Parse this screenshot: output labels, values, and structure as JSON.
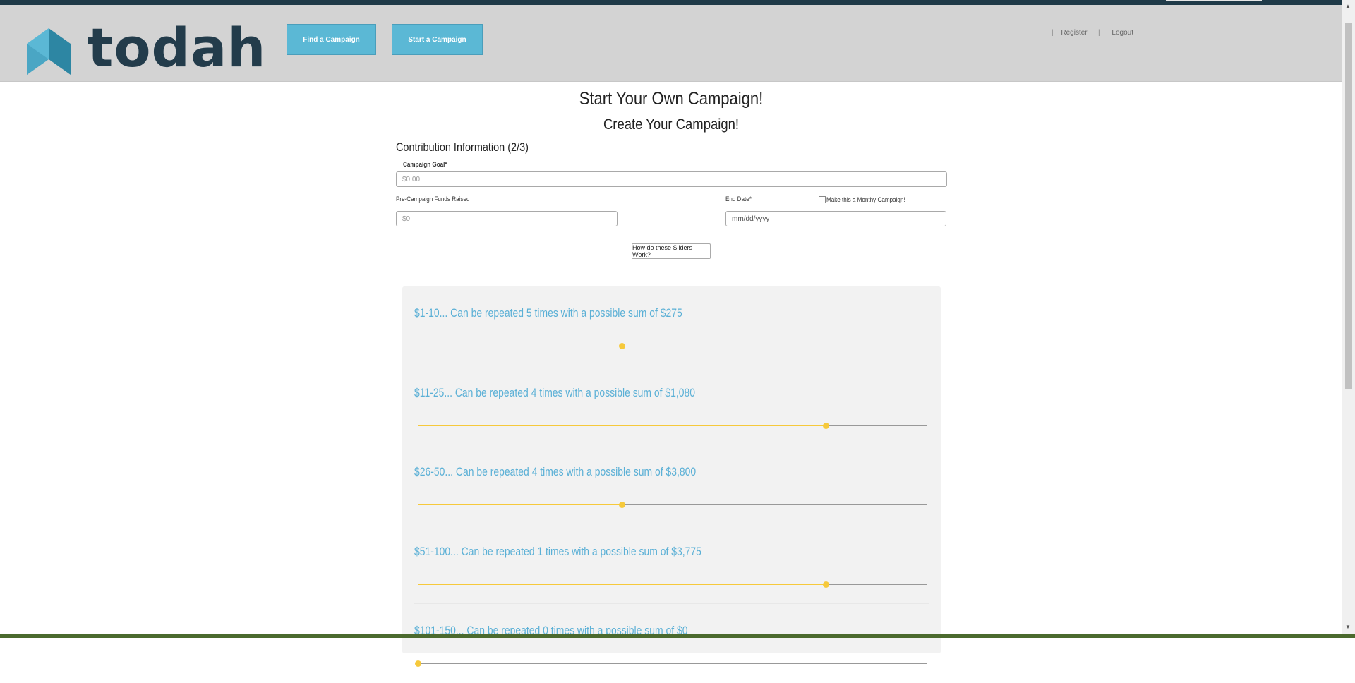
{
  "brand": {
    "name": "todah",
    "logo_colors": {
      "light": "#5bb8d5",
      "dark": "#2d86a3",
      "text": "#233c4b"
    }
  },
  "nav": {
    "find_label": "Find a Campaign",
    "start_label": "Start a Campaign"
  },
  "user_links": {
    "sep": "|",
    "register": "Register",
    "logout": "Logout"
  },
  "page": {
    "title": "Start Your Own Campaign!",
    "subtitle": "Create Your Campaign!",
    "section": "Contribution Information (2/3)"
  },
  "form": {
    "goal_label": "Campaign Goal*",
    "goal_placeholder": "$0.00",
    "pre_funds_label": "Pre-Campaign Funds Raised",
    "pre_funds_placeholder": "$0",
    "end_date_label": "End Date*",
    "monthly_label": "Make this a Monthy Campaign!",
    "monthly_checked": false,
    "end_date_placeholder": "mm/dd/yyyy",
    "help_button": "How do these Sliders Work?"
  },
  "tiers": [
    {
      "title": "$1-10... Can be repeated 5 times with a possible sum of $275",
      "slider_fraction": 0.4
    },
    {
      "title": "$11-25... Can be repeated 4 times with a possible sum of $1,080",
      "slider_fraction": 0.8
    },
    {
      "title": "$26-50... Can be repeated 4 times with a possible sum of $3,800",
      "slider_fraction": 0.4
    },
    {
      "title": "$51-100... Can be repeated 1 times with a possible sum of $3,775",
      "slider_fraction": 0.8
    },
    {
      "title": "$101-150... Can be repeated 0 times with a possible sum of $0",
      "slider_fraction": 0.0
    }
  ],
  "colors": {
    "accent": "#5bb8d5",
    "slider": "#f6c93b",
    "tier_title": "#5bb0d6",
    "header_bg": "#d3d3d3"
  }
}
